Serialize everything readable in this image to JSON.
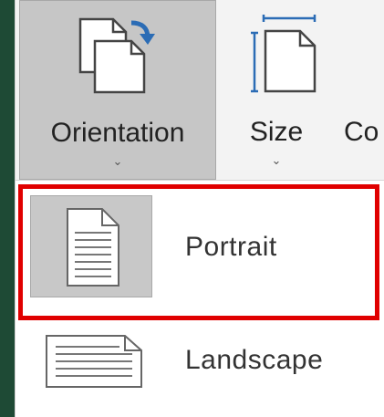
{
  "ribbon": {
    "orientation": {
      "label": "Orientation",
      "chevron": "⌄",
      "icon": "page-orientation-icon"
    },
    "size": {
      "label": "Size",
      "chevron": "⌄",
      "icon": "page-size-icon"
    },
    "next": {
      "label": "Co"
    }
  },
  "menu": {
    "items": [
      {
        "label": "Portrait",
        "icon": "portrait-page-icon",
        "selected": true
      },
      {
        "label": "Landscape",
        "icon": "landscape-page-icon",
        "selected": false
      }
    ]
  },
  "colors": {
    "highlight": "#e00000",
    "selected_bg": "#c8c8c8",
    "background": "#1e4a35",
    "accent_arrow": "#2b6cb5"
  }
}
